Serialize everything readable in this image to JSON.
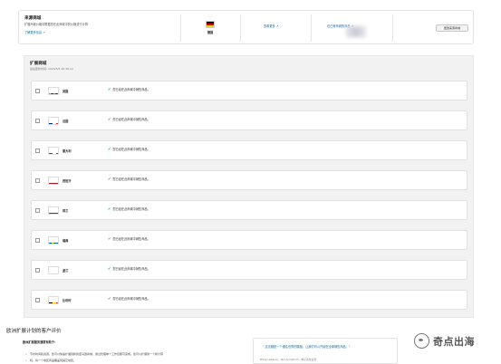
{
  "source_marketplace": {
    "title": "来源商城",
    "description": "扩展商城价格将根据您在此商城中的价格进行计算",
    "manage_link": "了解更多信息",
    "flag_icon": "germany-flag-icon",
    "country": "德国",
    "link_middle": "查看更多",
    "link_right": "在已有商城的商品",
    "button": "更改来源商城"
  },
  "expansion": {
    "title": "扩展商城",
    "subtitle": "最后更新时间: 2020/5/5 20:36:12",
    "status_icon": "checkmark-icon",
    "marketplaces": [
      {
        "name": "英国",
        "status": "您已经在此商城中销售商品。",
        "flag_icon": "uk-flag-icon"
      },
      {
        "name": "法国",
        "status": "您已经在此商城中销售商品。",
        "flag_icon": "france-flag-icon"
      },
      {
        "name": "意大利",
        "status": "您已经在此商城中销售商品。",
        "flag_icon": "italy-flag-icon"
      },
      {
        "name": "西班牙",
        "status": "您已经在此商城中销售商品。",
        "flag_icon": "spain-flag-icon"
      },
      {
        "name": "荷兰",
        "status": "您已经在此商城中销售商品。",
        "flag_icon": "netherlands-flag-icon"
      },
      {
        "name": "瑞典",
        "status": "您已经在此商城中销售商品。",
        "flag_icon": "sweden-flag-icon"
      },
      {
        "name": "波兰",
        "status": "您已经在此商城中销售商品。",
        "flag_icon": "poland-flag-icon"
      },
      {
        "name": "比利时",
        "status": "您已经在此商城中销售商品。",
        "flag_icon": "belgium-flag-icon"
      }
    ]
  },
  "reviews": {
    "title": "欧洲扩展计划的客户评价",
    "subtitle": "欧洲扩展服务通常有助于:",
    "bullet1": "节省时间和资源，您可以快速扩展到新的亚马逊商城，通过管理单个工作目即可完成。您可以扩展到一个新计算",
    "bullet2": "机，将一个地区商品覆盖到其它地区。",
    "quote": "\" 这无疑是一个通往世界的跳板，让我们可以开始在全球销售商品。\"",
    "attribution": "Philip Lebanon，Bio-Armstrum，电子商务主管"
  },
  "watermark": {
    "text": "奇点出海",
    "icon": "wechat-official-account-icon"
  }
}
